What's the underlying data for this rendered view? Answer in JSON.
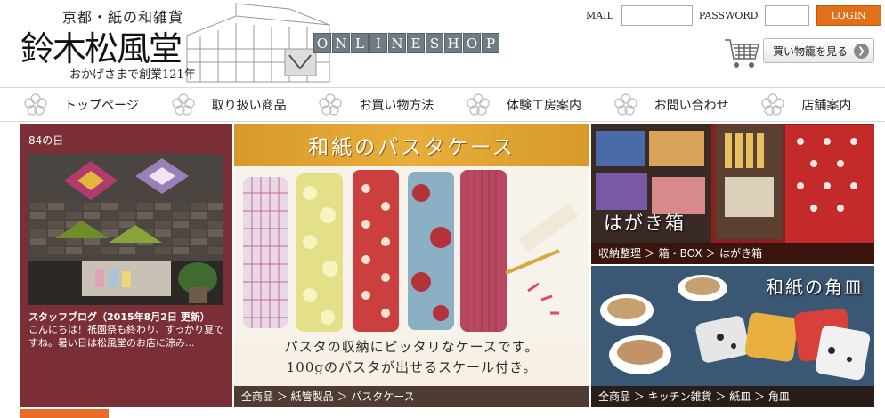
{
  "header": {
    "tagline": "京都・紙の和雑貨",
    "store_name": "鈴木松風堂",
    "since": "おかげさまで創業121年",
    "online_shop": [
      "O",
      "N",
      "L",
      "I",
      "N",
      "E",
      "S",
      "H",
      "O",
      "P"
    ],
    "login": {
      "mail_label": "MAIL",
      "password_label": "PASSWORD",
      "button_label": "LOGIN",
      "mail_value": "",
      "password_value": ""
    },
    "cart": {
      "button_label": "買い物籠を見る",
      "icon": "shopping-cart-icon"
    }
  },
  "nav": {
    "items": [
      {
        "label": "トップページ"
      },
      {
        "label": "取り扱い商品"
      },
      {
        "label": "お買い物方法"
      },
      {
        "label": "体験工房案内"
      },
      {
        "label": "お問い合わせ"
      },
      {
        "label": "店舗案内"
      }
    ],
    "icon": "sakura-flower-icon"
  },
  "blog": {
    "date": "84の日",
    "title": "スタッフブログ（2015年8月2日 更新）",
    "text": "こんにちは！祇園祭も終わり、すっかり夏ですね。暑い日は松風堂のお店に涼み..."
  },
  "pasta": {
    "heading": "和紙のパスタケース",
    "copy_line1": "パスタの収納にピッタリなケースです。",
    "copy_line2": "100gのパスタが出せるスケール付き。",
    "breadcrumb": "全商品 ＞ 紙管製品 ＞ パスタケース"
  },
  "card_box": {
    "label": "はがき箱",
    "breadcrumb": "収納整理 ＞ 箱・BOX ＞ はがき箱"
  },
  "kitchen": {
    "label": "和紙の角皿",
    "breadcrumb": "全商品 ＞ キッチン雑貨 ＞ 紙皿 ＞ 角皿"
  },
  "colors": {
    "accent_orange": "#e2701a",
    "blog_bg": "#7a2e35",
    "band_gold": "#e8ad3a",
    "onlineshop_tile": "#6f7c84"
  }
}
